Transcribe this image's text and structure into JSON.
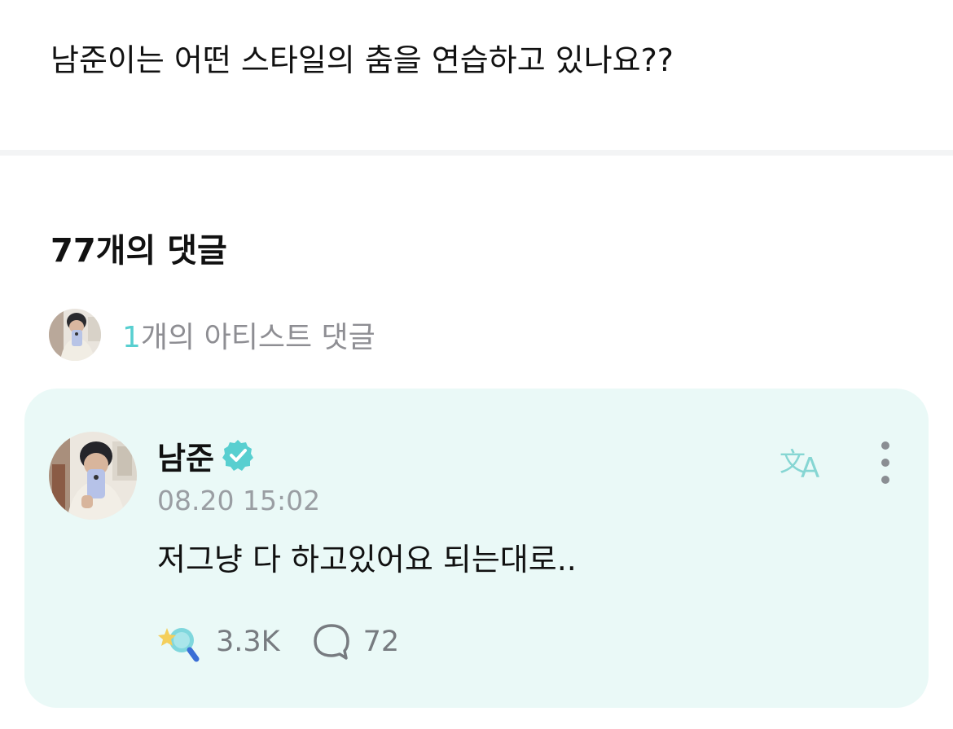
{
  "post": {
    "text": "남준이는 어떤 스타일의 춤을 연습하고 있나요??"
  },
  "comments_section": {
    "title": "77개의 댓글",
    "artist_summary": {
      "count": "1",
      "label": "개의 아티스트 댓글"
    }
  },
  "comment": {
    "author": "남준",
    "verified_icon": "verified-badge-icon",
    "timestamp": "08.20 15:02",
    "body": "저그냥 다 하고있어요 되는대로..",
    "reactions": "3.3K",
    "replies": "72",
    "translate_icon": "translate-icon",
    "more_icon": "more-vertical-icon"
  },
  "colors": {
    "accent": "#58cfd0",
    "card_bg": "#eaf9f7",
    "muted": "#8e8e93"
  }
}
